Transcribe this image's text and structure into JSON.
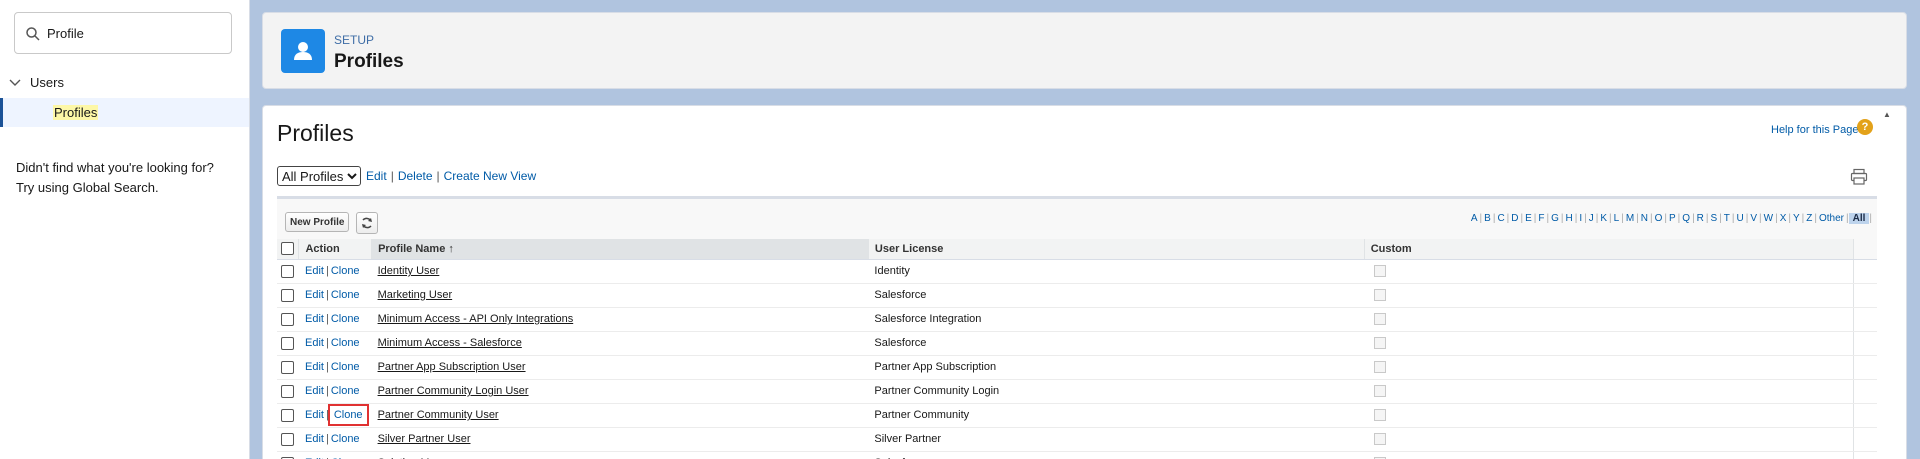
{
  "sidebar": {
    "search_value": "Profile",
    "tree_parent": "Users",
    "tree_child": "Profiles",
    "help_line1": "Didn't find what you're looking for?",
    "help_line2": "Try using Global Search."
  },
  "header": {
    "breadcrumb": "SETUP",
    "title": "Profiles",
    "icon": "user-icon",
    "accent": "#1e88e5"
  },
  "main": {
    "title": "Profiles",
    "help_link": "Help for this Page",
    "help_icon": "?",
    "view_select": "All Profiles",
    "view_links": [
      "Edit",
      "Delete",
      "Create New View"
    ],
    "new_button": "New Profile",
    "alphabet": [
      "A",
      "B",
      "C",
      "D",
      "E",
      "F",
      "G",
      "H",
      "I",
      "J",
      "K",
      "L",
      "M",
      "N",
      "O",
      "P",
      "Q",
      "R",
      "S",
      "T",
      "U",
      "V",
      "W",
      "X",
      "Y",
      "Z",
      "Other",
      "All"
    ],
    "alphabet_active": "All",
    "columns": [
      "Action",
      "Profile Name",
      "User License",
      "Custom"
    ],
    "sort_indicator": "↑",
    "action_edit": "Edit",
    "action_clone": "Clone",
    "rows": [
      {
        "name": "Identity User",
        "license": "Identity"
      },
      {
        "name": "Marketing User",
        "license": "Salesforce"
      },
      {
        "name": "Minimum Access - API Only Integrations",
        "license": "Salesforce Integration"
      },
      {
        "name": "Minimum Access - Salesforce",
        "license": "Salesforce"
      },
      {
        "name": "Partner App Subscription User",
        "license": "Partner App Subscription"
      },
      {
        "name": "Partner Community Login User",
        "license": "Partner Community Login"
      },
      {
        "name": "Partner Community User",
        "license": "Partner Community",
        "highlight_clone": true
      },
      {
        "name": "Silver Partner User",
        "license": "Silver Partner"
      },
      {
        "name": "Solution Manager",
        "license": "Salesforce"
      }
    ]
  }
}
